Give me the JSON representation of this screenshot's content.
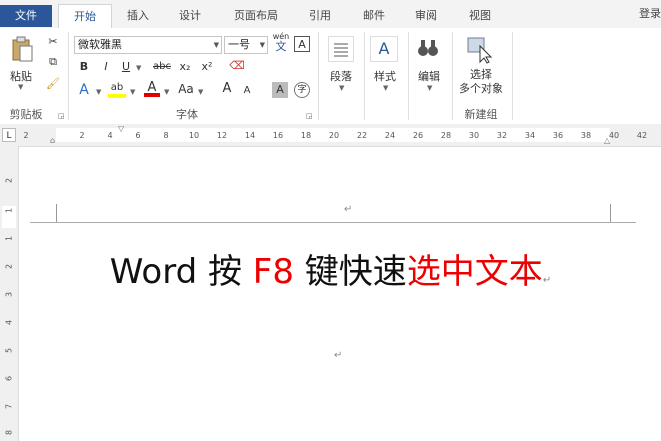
{
  "tabs": {
    "file": "文件",
    "home": "开始",
    "insert": "插入",
    "design": "设计",
    "layout": "页面布局",
    "references": "引用",
    "mailings": "邮件",
    "review": "审阅",
    "view": "视图",
    "login": "登录"
  },
  "ribbon": {
    "clipboard": {
      "paste": "粘贴",
      "group_label": "剪贴板"
    },
    "font": {
      "font_name": "微软雅黑",
      "font_size": "一号",
      "wen": "wén",
      "wen_char": "文",
      "a_border": "A",
      "bold": "B",
      "italic": "I",
      "underline": "U",
      "strike": "abc",
      "sub": "x₂",
      "sup": "x²",
      "text_effects": "A",
      "highlight": "ab",
      "font_color": "A",
      "change_case": "Aa",
      "grow": "A",
      "shrink": "A",
      "char_shade": "A",
      "enclose": "字",
      "group_label": "字体"
    },
    "paragraph": {
      "label": "段落"
    },
    "styles": {
      "label": "样式"
    },
    "editing": {
      "label": "编辑"
    },
    "new_group": {
      "select_line1": "选择",
      "select_line2": "多个对象",
      "group_label": "新建组"
    }
  },
  "ruler": {
    "corner": "L",
    "ticks": [
      "2",
      "2",
      "4",
      "6",
      "8",
      "10",
      "12",
      "14",
      "16",
      "18",
      "20",
      "22",
      "24",
      "26",
      "28",
      "30",
      "32",
      "34",
      "36",
      "38",
      "40",
      "42"
    ],
    "vticks": [
      "2",
      "1",
      "1",
      "2",
      "3",
      "4",
      "5",
      "6",
      "7",
      "8"
    ]
  },
  "document": {
    "header_mark": "↵",
    "title_part1": "Word 按 ",
    "title_part2": "F8",
    "title_part3": " 键快速",
    "title_part4": "选中文本",
    "title_mark": "↵",
    "empty_mark": "↵"
  },
  "colors": {
    "file_tab": "#2b579a",
    "accent_red": "#ee0000",
    "highlight": "#ffff00",
    "font_color": "#e00000"
  }
}
